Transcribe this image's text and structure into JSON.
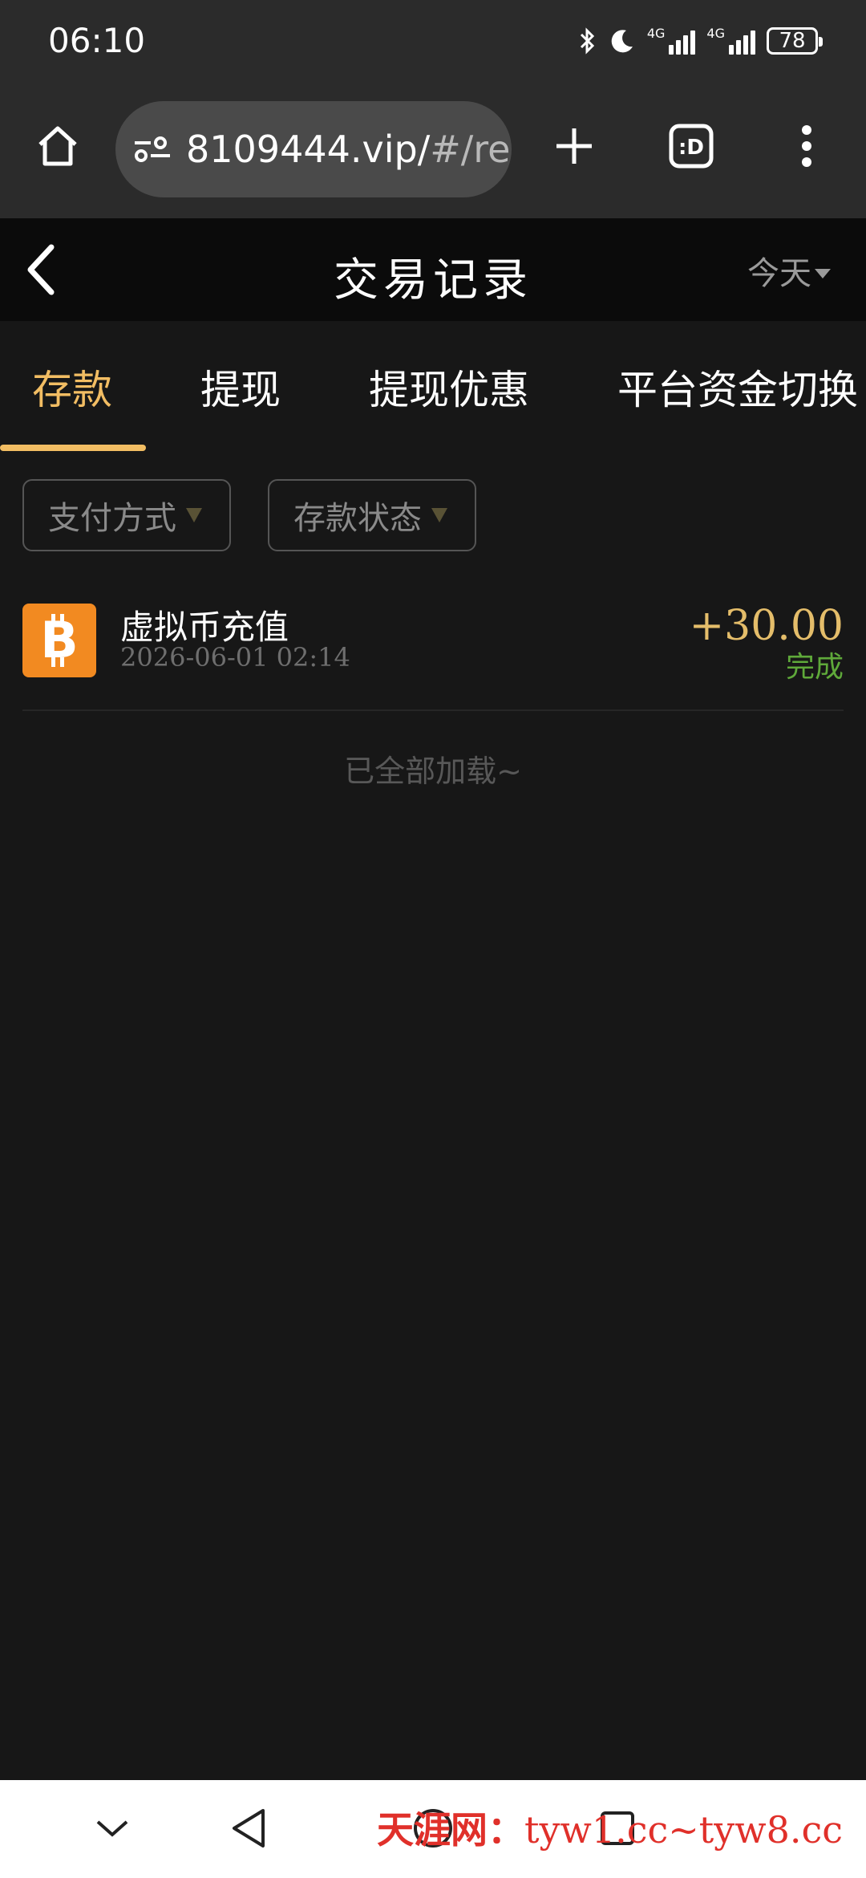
{
  "status_bar": {
    "time": "06:10",
    "sig1": "4G",
    "sig2": "4G",
    "battery": "78"
  },
  "browser": {
    "url_main": "8109444.vip/",
    "url_tail": "#/re"
  },
  "header": {
    "title": "交易记录",
    "filter": "今天"
  },
  "tabs": [
    {
      "label": "存款",
      "active": true
    },
    {
      "label": "提现",
      "active": false
    },
    {
      "label": "提现优惠",
      "active": false
    },
    {
      "label": "平台资金切换",
      "active": false
    }
  ],
  "filters": {
    "payment": "支付方式",
    "status": "存款状态"
  },
  "records": [
    {
      "title": "虚拟币充值",
      "time": "2026-06-01 02:14",
      "amount": "+30.00",
      "status": "完成",
      "icon": "bitcoin-icon"
    }
  ],
  "end_note": "已全部加载~",
  "watermark": {
    "brand": "天涯网：",
    "sites": "tyw1.cc~tyw8.cc"
  },
  "colors": {
    "accent": "#f2bd63",
    "amount": "#e4bd6a",
    "success": "#5fa93a",
    "coin": "#f28a21"
  }
}
